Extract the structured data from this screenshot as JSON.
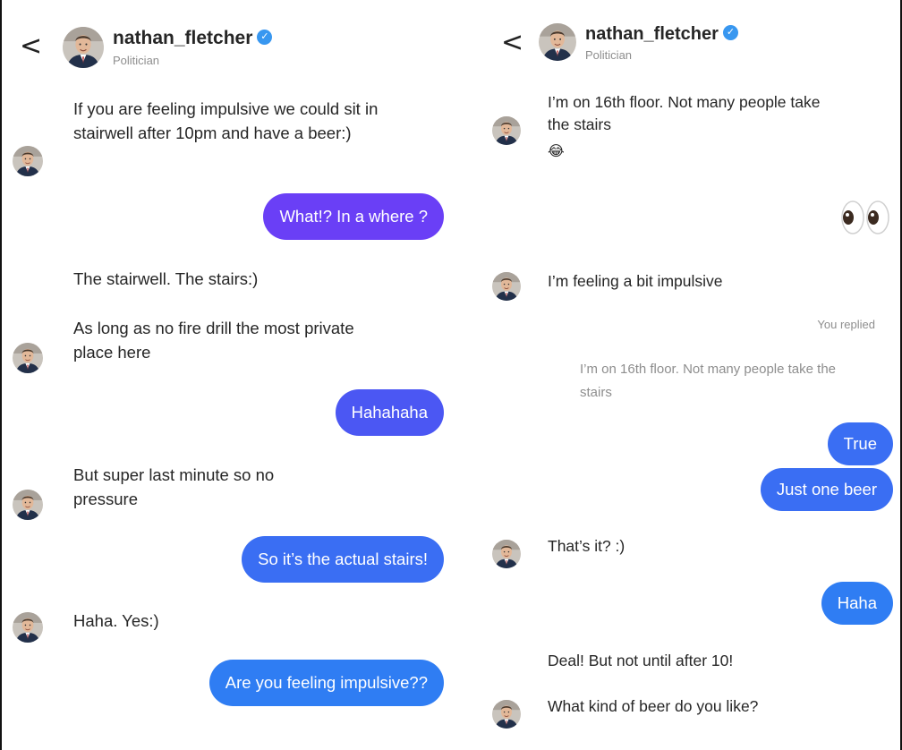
{
  "contact": {
    "name": "nathan_fletcher",
    "subtitle": "Politician",
    "back_glyph": "<",
    "verified_glyph": "✓"
  },
  "left_panel": {
    "messages": [
      {
        "from": "them",
        "text": "If you are feeling impulsive we could sit in stairwell after 10pm and have a beer:)"
      },
      {
        "from": "me",
        "text": "What!?  In a where ?"
      },
      {
        "from": "them",
        "text": "The stairwell. The stairs:)"
      },
      {
        "from": "them",
        "text": "As long as no fire drill the most private place here"
      },
      {
        "from": "me",
        "text": "Hahahaha"
      },
      {
        "from": "them",
        "text": "But super last minute so no pressure"
      },
      {
        "from": "me",
        "text": "So it’s the actual stairs!"
      },
      {
        "from": "them",
        "text": "Haha. Yes:)"
      },
      {
        "from": "me",
        "text": "Are you feeling impulsive??"
      }
    ]
  },
  "right_panel": {
    "messages": [
      {
        "from": "them",
        "text": "I’m on 16th floor. Not many people take the stairs"
      },
      {
        "from": "them",
        "text": "😂"
      },
      {
        "from": "me",
        "text": "👀"
      },
      {
        "from": "them",
        "text": "I’m feeling a bit impulsive"
      },
      {
        "from": "me",
        "text": "True"
      },
      {
        "from": "me",
        "text": "Just one beer"
      },
      {
        "from": "them",
        "text": "That’s it? :)"
      },
      {
        "from": "me",
        "text": "Haha"
      },
      {
        "from": "them",
        "text": "Deal! But not until after 10!"
      },
      {
        "from": "them",
        "text": "What kind of beer do you like?"
      }
    ],
    "reply_label": "You replied",
    "quoted_text": "I’m on 16th floor. Not many people take the stairs"
  },
  "colors": {
    "purple_bubble": "#6a3ff6",
    "blue_bubble_1": "#4b57f3",
    "blue_bubble_2": "#3a6ef3",
    "blue_bubble_3": "#2f7df3",
    "verified_badge": "#3897f0",
    "secondary_text": "#8e8e8e"
  }
}
